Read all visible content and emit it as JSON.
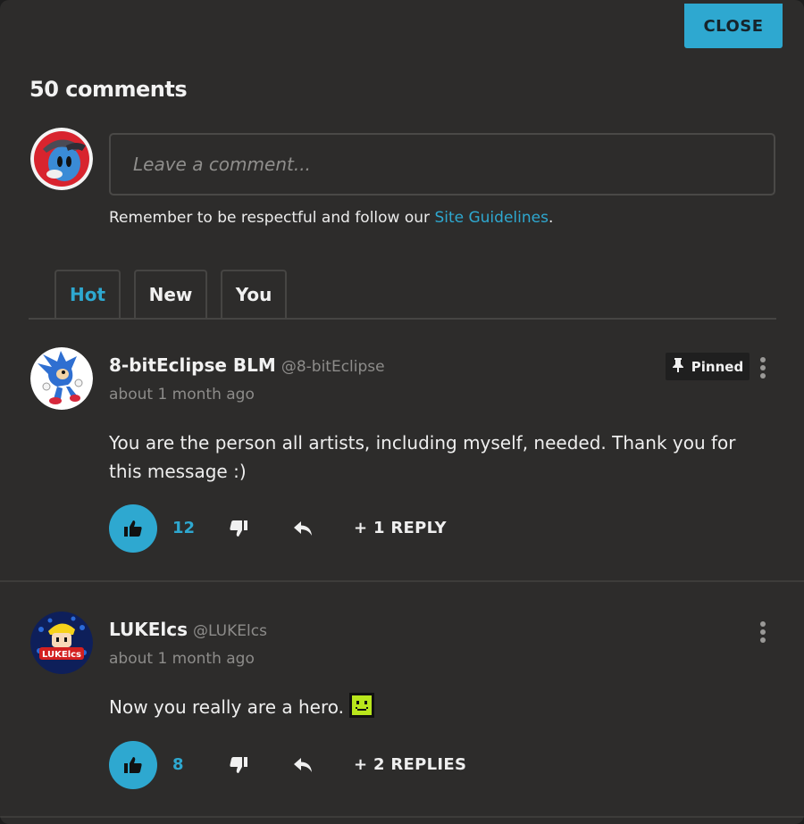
{
  "header": {
    "close_label": "CLOSE",
    "comment_count": "50 comments"
  },
  "composer": {
    "placeholder": "Leave a comment...",
    "note_prefix": "Remember to be respectful and follow our ",
    "guidelines_link": "Site Guidelines",
    "note_suffix": "."
  },
  "tabs": [
    {
      "label": "Hot",
      "active": true
    },
    {
      "label": "New",
      "active": false
    },
    {
      "label": "You",
      "active": false
    }
  ],
  "comments": [
    {
      "author": "8-bitEclipse BLM",
      "handle": "@8-bitEclipse",
      "time": "about 1 month ago",
      "text": "You are the person all artists, including myself, needed. Thank you for this message :)",
      "pinned_label": "Pinned",
      "likes": "12",
      "replies_label": "+ 1 REPLY"
    },
    {
      "author": "LUKElcs",
      "handle": "@LUKElcs",
      "time": "about 1 month ago",
      "text": "Now you really are a hero.",
      "emote": "smiley-emote",
      "likes": "8",
      "replies_label": "+ 2 REPLIES"
    }
  ],
  "colors": {
    "accent": "#2ea8d0",
    "panel": "#2d2c2b",
    "muted": "#8d8c8a"
  }
}
